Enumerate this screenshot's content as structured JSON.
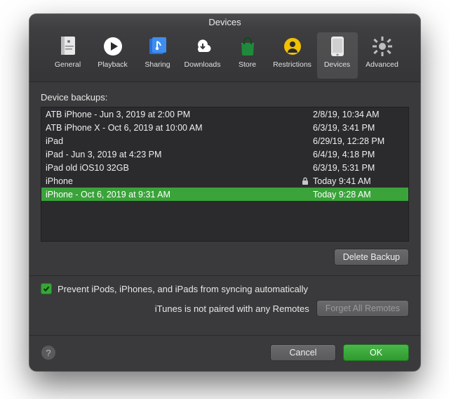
{
  "window": {
    "title": "Devices"
  },
  "toolbar": {
    "tabs": [
      {
        "id": "general",
        "label": "General"
      },
      {
        "id": "playback",
        "label": "Playback"
      },
      {
        "id": "sharing",
        "label": "Sharing"
      },
      {
        "id": "downloads",
        "label": "Downloads"
      },
      {
        "id": "store",
        "label": "Store"
      },
      {
        "id": "restrictions",
        "label": "Restrictions"
      },
      {
        "id": "devices",
        "label": "Devices"
      },
      {
        "id": "advanced",
        "label": "Advanced"
      }
    ],
    "selected": "devices"
  },
  "devices": {
    "section_label": "Device backups:",
    "rows": [
      {
        "name": "ATB iPhone - Jun 3, 2019 at 2:00 PM",
        "locked": false,
        "date": "2/8/19, 10:34 AM"
      },
      {
        "name": "ATB iPhone X - Oct 6, 2019 at 10:00 AM",
        "locked": false,
        "date": "6/3/19, 3:41 PM"
      },
      {
        "name": "iPad",
        "locked": false,
        "date": "6/29/19, 12:28 PM"
      },
      {
        "name": "iPad - Jun 3, 2019 at 4:23 PM",
        "locked": false,
        "date": "6/4/19, 4:18 PM"
      },
      {
        "name": "iPad old iOS10 32GB",
        "locked": false,
        "date": "6/3/19, 5:31 PM"
      },
      {
        "name": "iPhone",
        "locked": true,
        "date": "Today 9:41 AM"
      },
      {
        "name": "iPhone - Oct 6, 2019 at 9:31 AM",
        "locked": false,
        "date": "Today 9:28 AM"
      }
    ],
    "selected_index": 6,
    "delete_label": "Delete Backup"
  },
  "options": {
    "prevent_sync_checked": true,
    "prevent_sync_label": "Prevent iPods, iPhones, and iPads from syncing automatically",
    "remotes_status": "iTunes is not paired with any Remotes",
    "forget_remotes_label": "Forget All Remotes"
  },
  "footer": {
    "help": "?",
    "cancel": "Cancel",
    "ok": "OK"
  }
}
